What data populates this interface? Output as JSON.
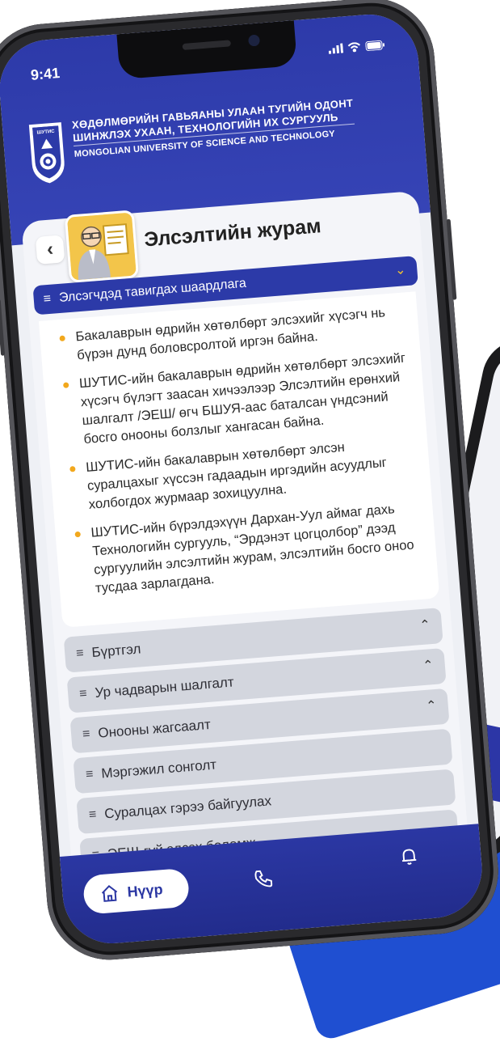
{
  "status_bar": {
    "time": "9:41"
  },
  "brand": {
    "badge_text": "ШУТИС",
    "line1": "Хөдөлмөрийн Гавьяаны Улаан Тугийн одонт",
    "line2": "Шинжлэх Ухаан, Технологийн Их Сургууль",
    "line3": "Mongolian University of Science and Technology"
  },
  "page": {
    "title": "Элсэлтийн журам"
  },
  "open_section": {
    "title": "Элсэгчдэд тавигдах шаардлага",
    "items": [
      "Бакалаврын өдрийн хөтөлбөрт элсэхийг хүсэгч нь бүрэн дунд боловсролтой иргэн байна.",
      "ШУТИС-ийн бакалаврын өдрийн хөтөлбөрт элсэхийг хүсэгч бүлэгт заасан хичээлээр Элсэлтийн ерөнхий шалгалт /ЭЕШ/ өгч БШУЯ-аас баталсан үндсэний босго онооны болзлыг хангасан байна.",
      "ШУТИС-ийн бакалаврын хөтөлбөрт элсэн суралцахыг хүссэн гадаадын иргэдийн асуудлыг холбогдох журмаар зохицуулна.",
      "ШУТИС-ийн бүрэлдэхүүн Дархан-Уул аймаг дахь Технологийн сургууль, “Эрдэнэт цогцолбор” дээд сургуулийн элсэлтийн журам, элсэлтийн босго оноо тусдаа зарлагдана."
    ]
  },
  "sections": [
    {
      "title": "Бүртгэл"
    },
    {
      "title": "Ур чадварын шалгалт"
    },
    {
      "title": "Онооны жагсаалт"
    },
    {
      "title": "Мэргэжил сонголт"
    },
    {
      "title": "Суралцах гэрээ байгуулах"
    },
    {
      "title": "ЭЕШ-гүй элсэх боломж"
    }
  ],
  "bottom_nav": {
    "home_label": "Нүүр"
  },
  "icons": {
    "menu": "menu-icon",
    "chevron_down": "chevron-down-icon",
    "chevron_up": "chevron-up-icon",
    "home": "home-icon",
    "phone": "phone-icon",
    "bell": "bell-icon",
    "back": "back-arrow-icon"
  },
  "colors": {
    "primary": "#2c3aa8",
    "bullet": "#f2a81d",
    "accordion_bg": "#d3d6de",
    "avatar_bg": "#f3c54a"
  }
}
